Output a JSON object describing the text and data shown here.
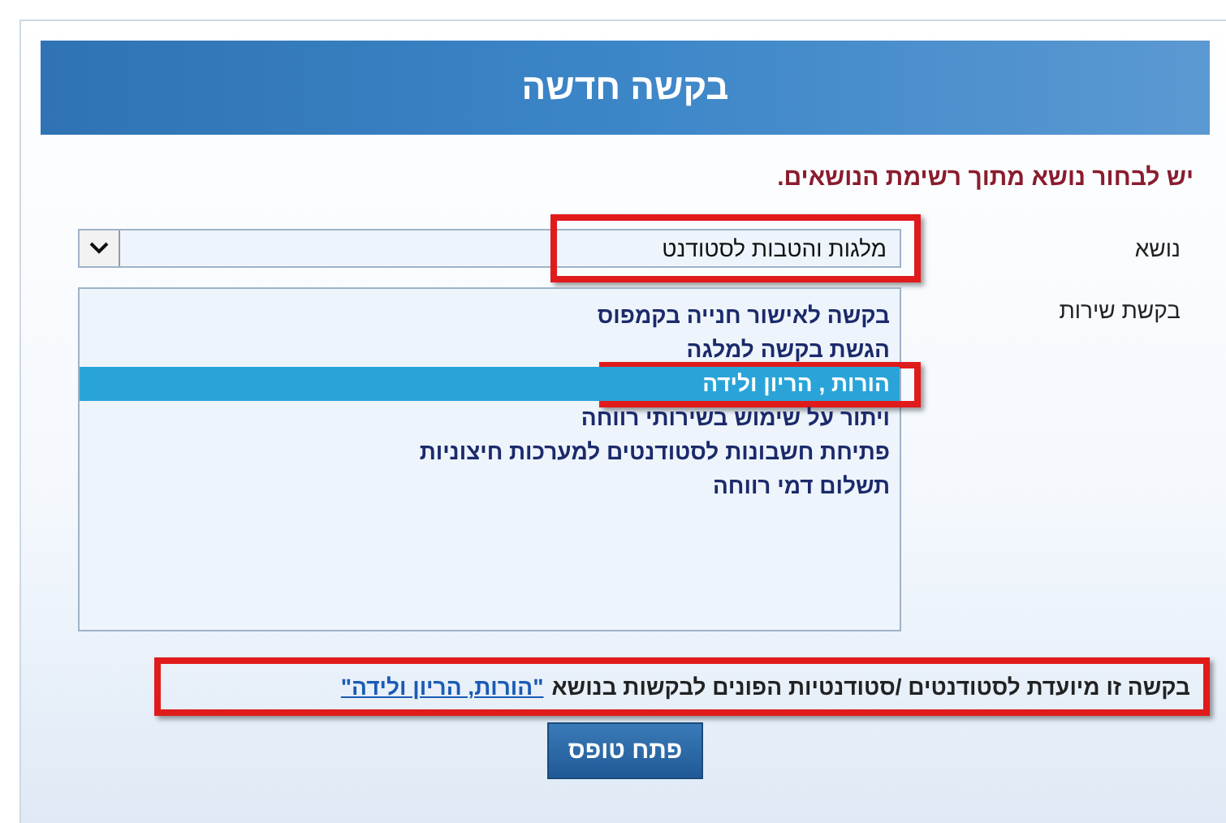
{
  "header": {
    "title": "בקשה חדשה"
  },
  "error_message": "יש לבחור נושא מתוך רשימת הנושאים.",
  "subject": {
    "label": "נושא",
    "value": "מלגות והטבות לסטודנט",
    "highlighted": true
  },
  "service": {
    "label": "בקשת שירות",
    "items": [
      {
        "label": "בקשה לאישור חנייה בקמפוס",
        "selected": false,
        "highlighted": false
      },
      {
        "label": "הגשת בקשה למלגה",
        "selected": false,
        "highlighted": false
      },
      {
        "label": "הורות , הריון ולידה",
        "selected": true,
        "highlighted": true
      },
      {
        "label": "ויתור על שימוש בשירותי רווחה",
        "selected": false,
        "highlighted": false
      },
      {
        "label": "פתיחת חשבונות לסטודנטים למערכות חיצוניות",
        "selected": false,
        "highlighted": false
      },
      {
        "label": "תשלום דמי רווחה",
        "selected": false,
        "highlighted": false
      }
    ]
  },
  "note": {
    "text": "בקשה זו מיועדת לסטודנטים /סטודנטיות הפונים לבקשות בנושא",
    "link": "\"הורות, הריון ולידה\"",
    "highlighted": true
  },
  "button": "פתח טופס"
}
